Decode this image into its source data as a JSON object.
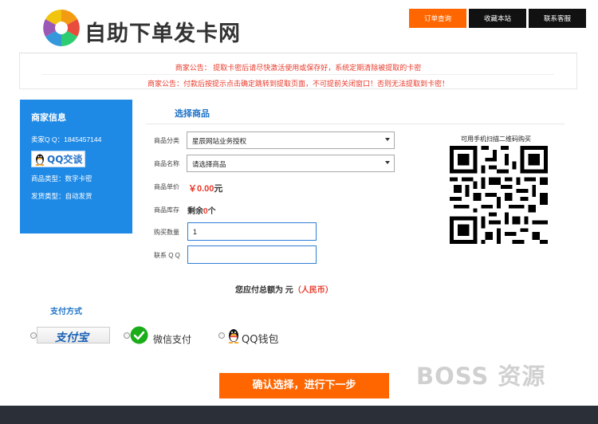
{
  "header": {
    "site_title": "自助下单发卡网",
    "nav": [
      {
        "label": "订单查询",
        "active": true
      },
      {
        "label": "收藏本站",
        "active": false
      },
      {
        "label": "联系客服",
        "active": false
      }
    ]
  },
  "notices": [
    "商家公告：  提取卡密后请尽快激活使用或保存好，系统定期清除被提取的卡密",
    "商家公告：付款后按提示点击确定跳转到提取页面，不可提前关闭窗口！否则无法提取到卡密！"
  ],
  "merchant": {
    "title": "商家信息",
    "seller_qq_label": "卖家Q Q：",
    "seller_qq": "1845457144",
    "qq_chat_label": "QQ交谈",
    "product_type_label": "商品类型：",
    "product_type": "数字卡密",
    "delivery_type_label": "发货类型：",
    "delivery_type": "自动发货"
  },
  "form": {
    "section_title": "选择商品",
    "category_label": "商品分类",
    "category_value": "星辰网站业务授权",
    "product_label": "商品名称",
    "product_value": "请选择商品",
    "price_label": "商品单价",
    "price_value": "￥0.00",
    "price_unit": "元",
    "stock_label": "商品库存",
    "stock_prefix": "剩余",
    "stock_count": "0",
    "stock_suffix": "个",
    "quantity_label": "购买数量",
    "quantity_value": "1",
    "contact_label": "联系 Q Q",
    "contact_value": ""
  },
  "qr": {
    "caption": "可用手机扫描二维码购买"
  },
  "total": {
    "prefix": "您应付总额为 元",
    "currency": "（人民币）"
  },
  "payment": {
    "title": "支付方式",
    "alipay_label": "支付宝",
    "wechat_label": "微信支付",
    "qqpay_label": "QQ钱包"
  },
  "submit_label": "确认选择，进行下一步",
  "watermark": "BOSS 资源",
  "colors": {
    "accent_orange": "#ff6600",
    "nav_dark": "#111111",
    "merchant_blue": "#1e8ae6",
    "notice_red": "#e83a2b",
    "title_blue": "#1e73c8",
    "footer": "#2b3038"
  }
}
